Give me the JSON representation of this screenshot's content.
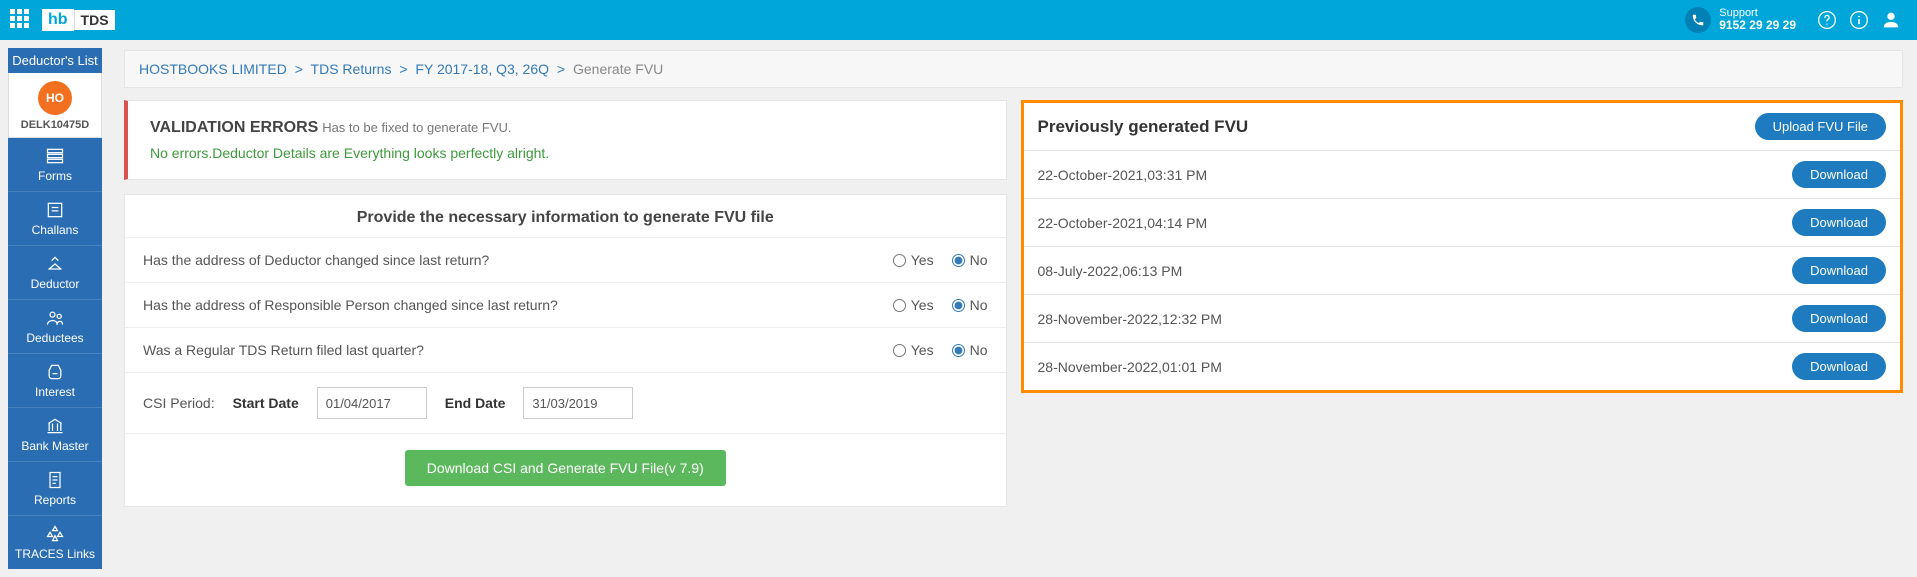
{
  "header": {
    "support_label": "Support",
    "support_phone": "9152 29 29 29",
    "logo_hb": "hb",
    "logo_tds": "TDS"
  },
  "sidebar": {
    "title": "Deductor's List",
    "avatar_initials": "HO",
    "tan": "DELK10475D",
    "items": [
      {
        "label": "Forms"
      },
      {
        "label": "Challans"
      },
      {
        "label": "Deductor"
      },
      {
        "label": "Deductees"
      },
      {
        "label": "Interest"
      },
      {
        "label": "Bank Master"
      },
      {
        "label": "Reports"
      },
      {
        "label": "TRACES Links"
      }
    ]
  },
  "breadcrumb": {
    "company": "HOSTBOOKS LIMITED",
    "section": "TDS Returns",
    "period": "FY 2017-18, Q3, 26Q",
    "page": "Generate FVU"
  },
  "validation": {
    "title": "VALIDATION ERRORS",
    "subtitle": "Has to be fixed to generate FVU.",
    "message": "No errors.Deductor Details are Everything looks perfectly alright."
  },
  "form": {
    "title": "Provide the necessary information to generate FVU file",
    "q1": "Has the address of Deductor changed since last return?",
    "q2": "Has the address of Responsible Person changed since last return?",
    "q3": "Was a Regular TDS Return filed last quarter?",
    "yes": "Yes",
    "no": "No",
    "csi_label": "CSI Period:",
    "start_label": "Start Date",
    "start_value": "01/04/2017",
    "end_label": "End Date",
    "end_value": "31/03/2019",
    "generate_btn": "Download CSI and Generate FVU File(v 7.9)"
  },
  "fvu": {
    "title": "Previously generated FVU",
    "upload_btn": "Upload FVU File",
    "download_btn": "Download",
    "rows": [
      {
        "ts": "22-October-2021,03:31 PM"
      },
      {
        "ts": "22-October-2021,04:14 PM"
      },
      {
        "ts": "08-July-2022,06:13 PM"
      },
      {
        "ts": "28-November-2022,12:32 PM"
      },
      {
        "ts": "28-November-2022,01:01 PM"
      }
    ]
  }
}
